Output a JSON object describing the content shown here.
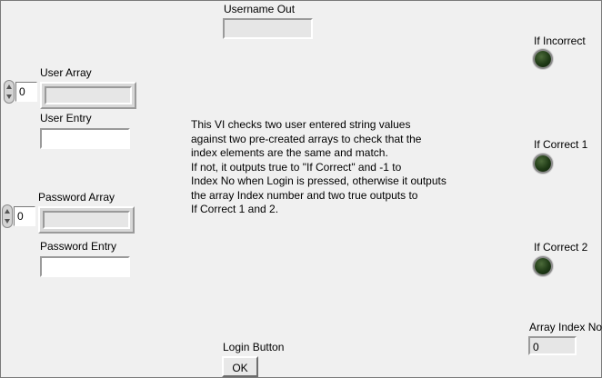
{
  "username_out": {
    "label": "Username Out",
    "value": ""
  },
  "user_array": {
    "label": "User Array",
    "index": "0",
    "element_value": ""
  },
  "user_entry": {
    "label": "User Entry",
    "value": ""
  },
  "password_array": {
    "label": "Password Array",
    "index": "0",
    "element_value": ""
  },
  "password_entry": {
    "label": "Password Entry",
    "value": ""
  },
  "description": "This VI checks two user entered string values\nagainst two pre-created arrays to check that the\nindex elements are the same and match.\nIf not, it outputs true to \"If Correct\" and -1 to\nIndex No when Login is pressed, otherwise it outputs\nthe array Index number and two true outputs to\nIf Correct 1 and 2.",
  "if_incorrect": {
    "label": "If Incorrect",
    "state": false
  },
  "if_correct_1": {
    "label": "If Correct 1",
    "state": false
  },
  "if_correct_2": {
    "label": "If Correct 2",
    "state": false
  },
  "array_index_no": {
    "label": "Array Index No",
    "value": "0"
  },
  "login_button": {
    "label": "Login Button",
    "button_text": "OK"
  },
  "colors": {
    "background": "#f0f0f0",
    "led_off": "#1f3a16"
  }
}
